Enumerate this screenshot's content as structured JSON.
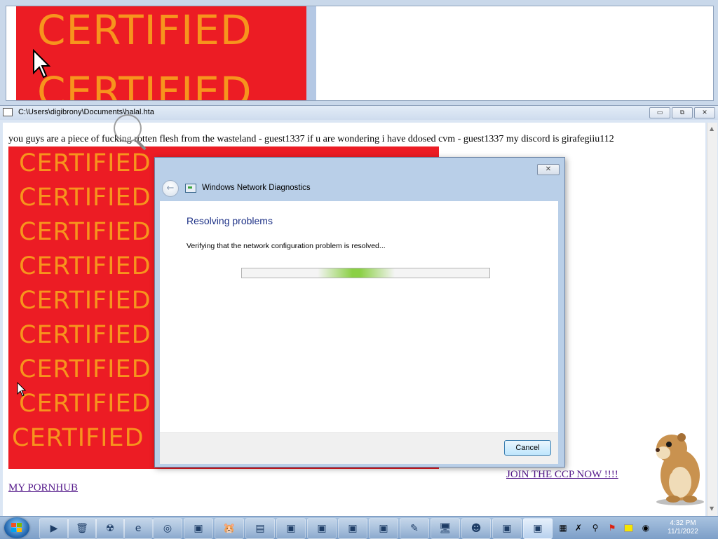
{
  "top_window": {
    "banner_words": [
      "CERTIFIED",
      "CERTIFIED"
    ]
  },
  "main_window": {
    "title": "C:\\Users\\digibrony\\Documents\\halal.hta",
    "minimize_label": "▭",
    "restore_label": "⧉",
    "close_label": "✕",
    "message": "you guys are a piece of fucking rotten flesh from the wasteland - guest1337 if u are wondering i have ddosed cvm - guest1337 my discord is girafegiiu112",
    "cert_words": [
      "CERTIFIED",
      "CERTIFIED",
      "CERTIFIED",
      "CERTIFIED",
      "CERTIFIED",
      "CERTIFIED",
      "CERTIFIED",
      "CERTIFIED",
      "CERTIFIED"
    ],
    "ccp_link": "JOIN THE CCP NOW !!!!",
    "ph_link": "MY PORNHUB"
  },
  "dialog": {
    "title": "Windows Network Diagnostics",
    "close_label": "✕",
    "back_label": "←",
    "heading": "Resolving problems",
    "status": "Verifying that the network configuration problem is resolved...",
    "cancel_label": "Cancel"
  },
  "taskbar": {
    "items": [
      "▶",
      "🗑",
      "☢",
      "e",
      "◎",
      "▣",
      "🐹",
      "▤",
      "▣",
      "▣",
      "▣",
      "▣",
      "✎",
      "🖥",
      "☻",
      "▣",
      "▣"
    ],
    "clock_time": "4:32 PM",
    "clock_date": "11/1/2022"
  },
  "colors": {
    "banner_red": "#ec1c24",
    "banner_text": "#f7941d",
    "link_purple": "#551a8b",
    "dialog_heading": "#1e3287",
    "progress_green": "#8bd046"
  },
  "icons": {
    "start": "windows-logo-icon",
    "tray": [
      "network-icon",
      "sword-icon",
      "magnifier-icon",
      "flag-icon",
      "note-icon",
      "speaker-icon"
    ]
  }
}
